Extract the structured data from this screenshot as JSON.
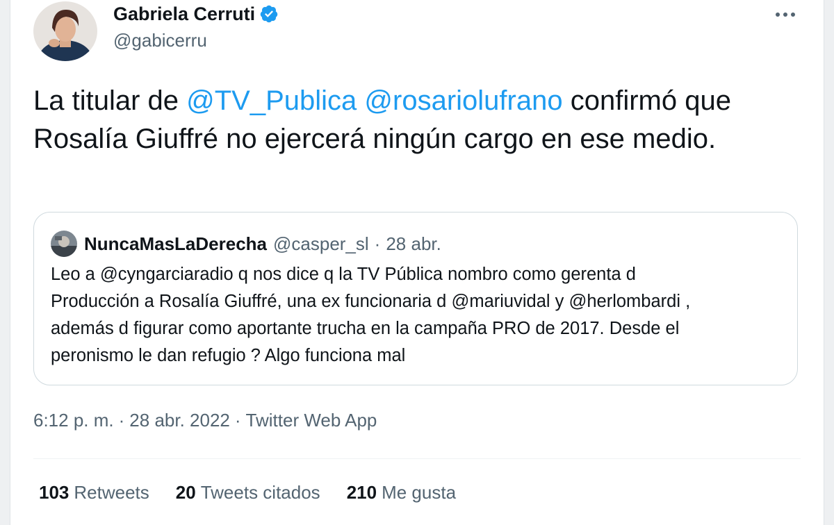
{
  "author": {
    "display_name": "Gabriela Cerruti",
    "handle": "@gabicerru",
    "verified": true
  },
  "tweet": {
    "text_before": "La titular de ",
    "mention_1": "@TV_Publica",
    "space": " ",
    "mention_2": "@rosariolufrano",
    "text_after": " confirmó que Rosalía Giuffré no ejercerá ningún cargo en ese medio."
  },
  "quoted_tweet": {
    "display_name": "NuncaMasLaDerecha",
    "handle": "@casper_sl",
    "separator": "·",
    "date": "28 abr.",
    "lines": [
      "Leo a @cyngarciaradio q nos dice q la TV Pública nombro como gerenta d",
      "Producción a Rosalía Giuffré, una ex funcionaria d @mariuvidal  y @herlombardi ,",
      "además d figurar como aportante trucha en la campaña PRO de 2017. Desde el",
      "peronismo le dan refugio ? Algo funciona mal"
    ]
  },
  "meta": {
    "time": "6:12 p. m.",
    "separator": "·",
    "date": "28 abr. 2022",
    "source": "Twitter Web App"
  },
  "stats": {
    "retweets_count": "103",
    "retweets_label": "Retweets",
    "quotes_count": "20",
    "quotes_label": "Tweets citados",
    "likes_count": "210",
    "likes_label": "Me gusta"
  },
  "colors": {
    "accent": "#1d9bf0",
    "text": "#0f1419",
    "secondary": "#536471",
    "border": "#cfd9de"
  },
  "icons": {
    "verified": "verified-badge-icon",
    "more": "more-options-icon"
  }
}
